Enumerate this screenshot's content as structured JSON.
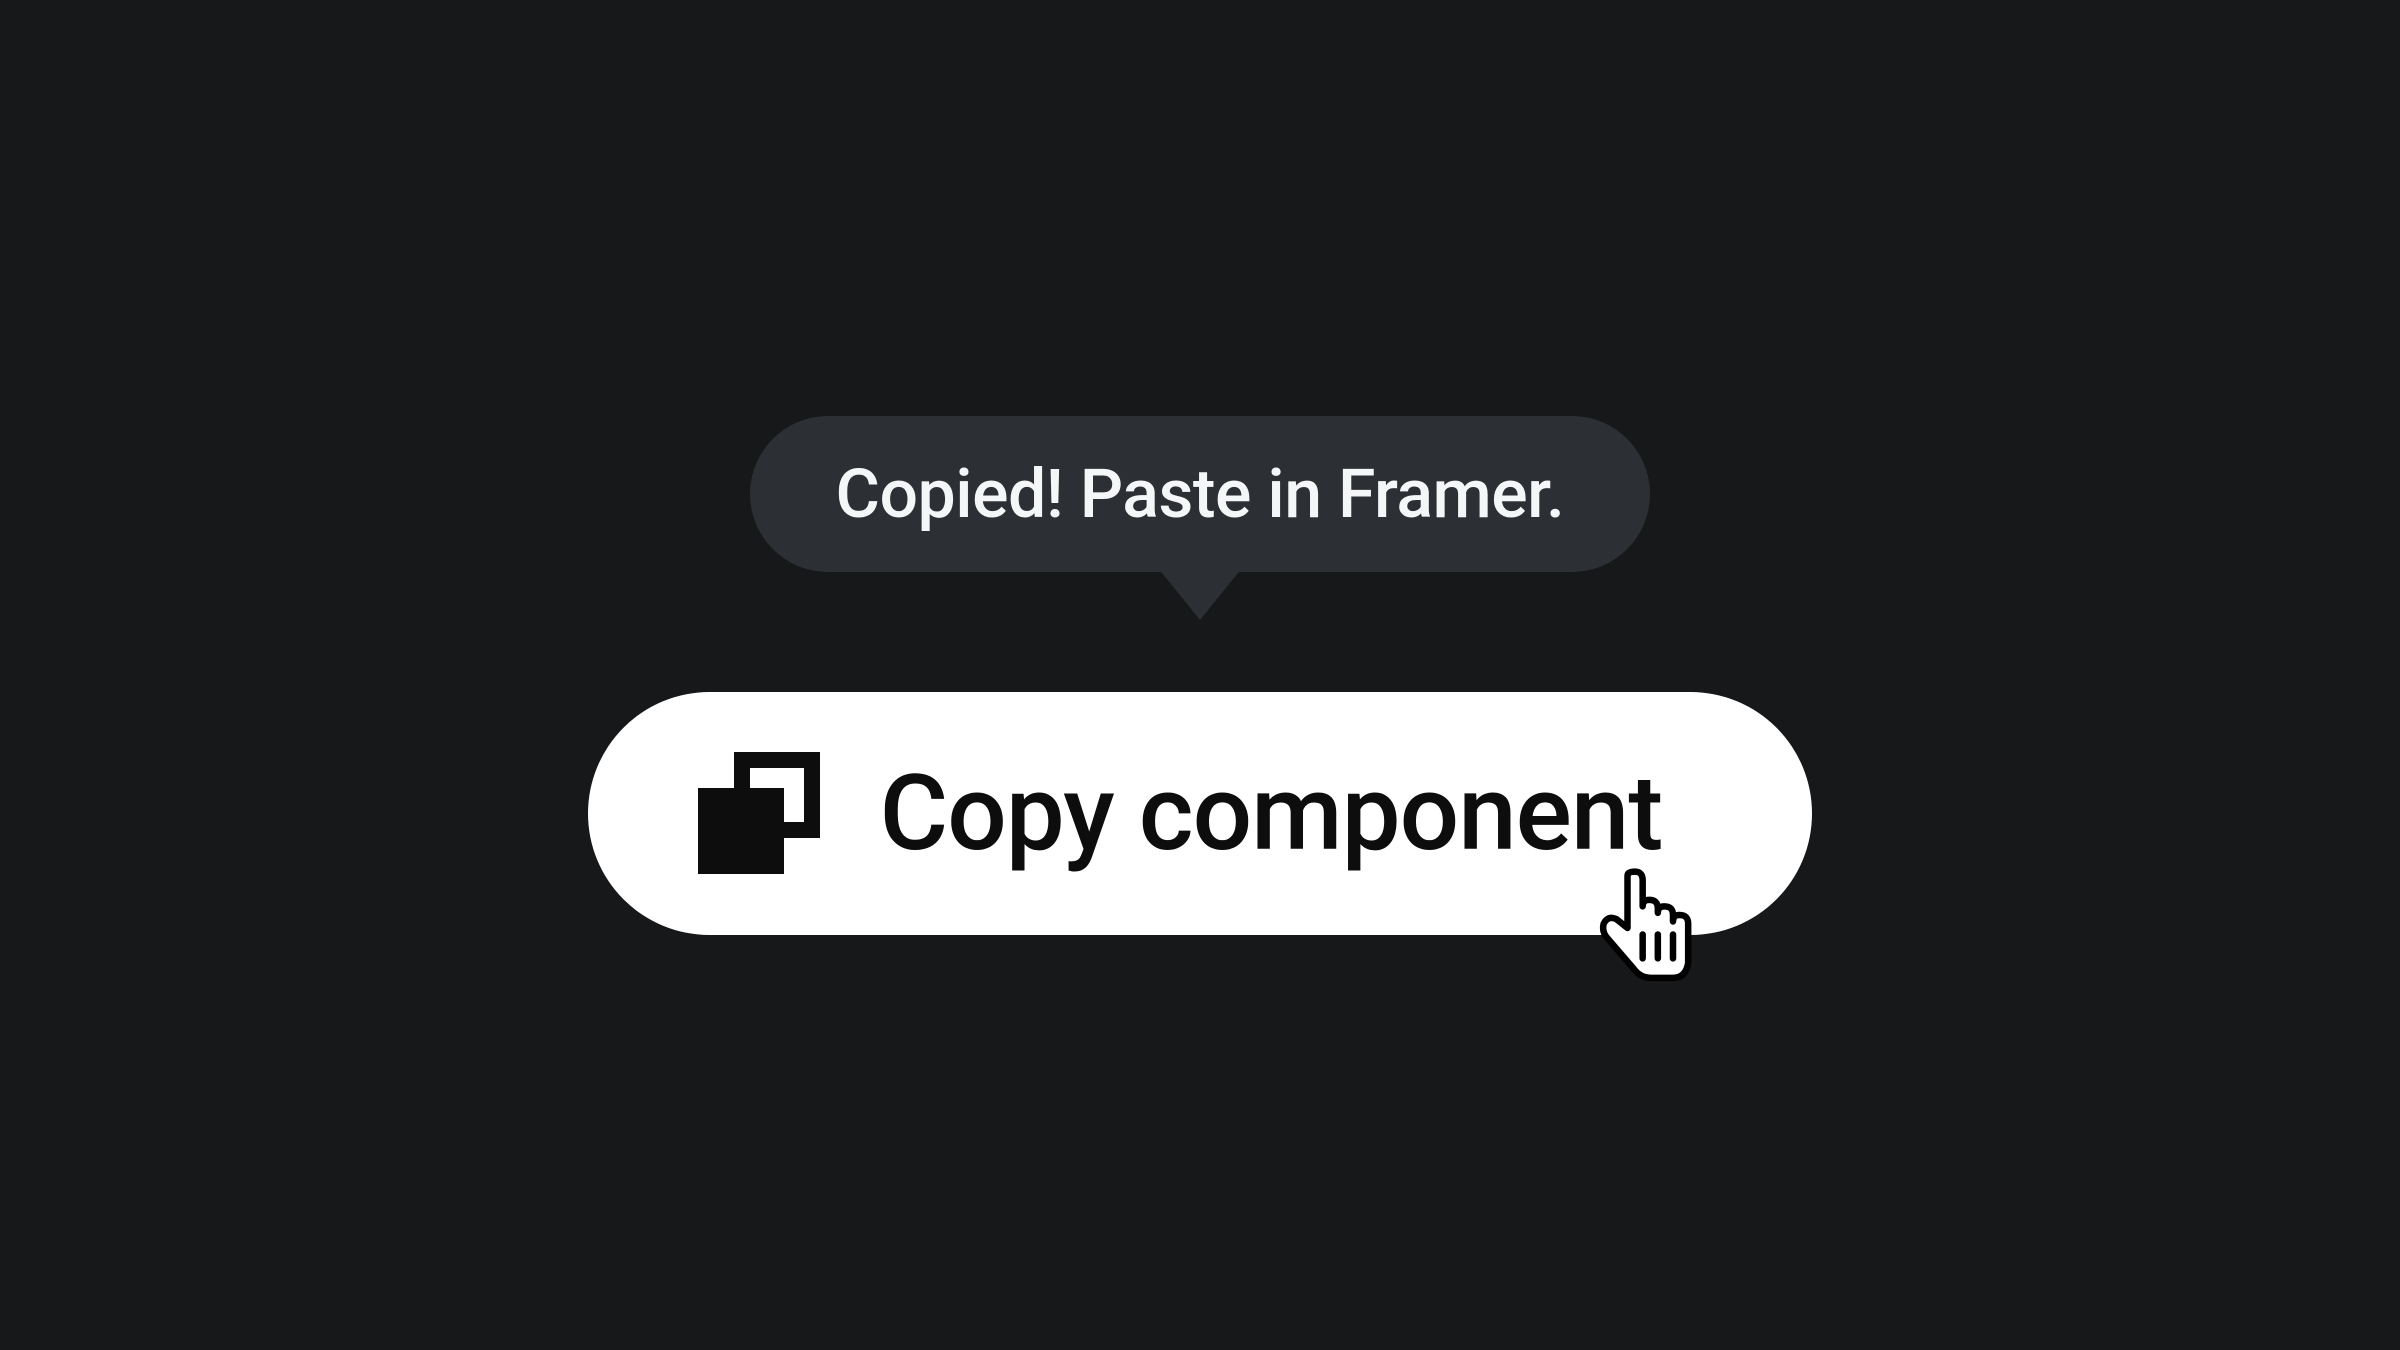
{
  "tooltip": {
    "text": "Copied! Paste in Framer."
  },
  "button": {
    "label": "Copy component"
  }
}
